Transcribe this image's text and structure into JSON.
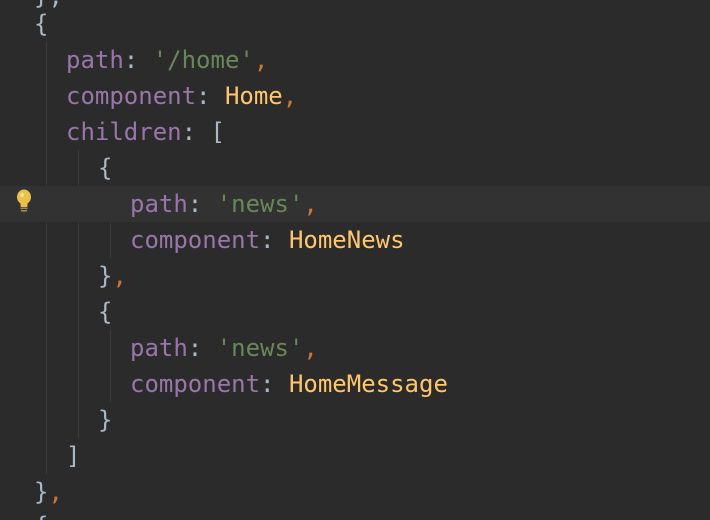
{
  "editor": {
    "colors": {
      "background": "#2b2b2b",
      "current_line": "#323232",
      "key": "#9876aa",
      "punctuation": "#cc7832",
      "string": "#6a8759",
      "identifier": "#ffc66d",
      "plain": "#a9b7c6"
    },
    "gutter_icon": "lightbulb-icon",
    "lines": [
      {
        "tokens": [
          {
            "text": "},",
            "cls": "tok-brace"
          }
        ]
      },
      {
        "tokens": [
          {
            "text": "{",
            "cls": "tok-brace"
          }
        ]
      },
      {
        "tokens": [
          {
            "text": "path",
            "cls": "tok-key"
          },
          {
            "text": ": ",
            "cls": "tok-plain"
          },
          {
            "text": "'/home'",
            "cls": "tok-str"
          },
          {
            "text": ",",
            "cls": "tok-punc"
          }
        ]
      },
      {
        "tokens": [
          {
            "text": "component",
            "cls": "tok-key"
          },
          {
            "text": ": ",
            "cls": "tok-plain"
          },
          {
            "text": "Home",
            "cls": "tok-ident"
          },
          {
            "text": ",",
            "cls": "tok-punc"
          }
        ]
      },
      {
        "tokens": [
          {
            "text": "children",
            "cls": "tok-key"
          },
          {
            "text": ": ",
            "cls": "tok-plain"
          },
          {
            "text": "[",
            "cls": "tok-brace"
          }
        ]
      },
      {
        "tokens": [
          {
            "text": "{",
            "cls": "tok-brace"
          }
        ]
      },
      {
        "tokens": [
          {
            "text": "path",
            "cls": "tok-key"
          },
          {
            "text": ": ",
            "cls": "tok-plain"
          },
          {
            "text": "'news'",
            "cls": "tok-str"
          },
          {
            "text": ",",
            "cls": "tok-punc"
          }
        ]
      },
      {
        "tokens": [
          {
            "text": "component",
            "cls": "tok-key"
          },
          {
            "text": ": ",
            "cls": "tok-plain"
          },
          {
            "text": "HomeNews",
            "cls": "tok-ident"
          }
        ]
      },
      {
        "tokens": [
          {
            "text": "}",
            "cls": "tok-brace"
          },
          {
            "text": ",",
            "cls": "tok-punc"
          }
        ]
      },
      {
        "tokens": [
          {
            "text": "{",
            "cls": "tok-brace"
          }
        ]
      },
      {
        "tokens": [
          {
            "text": "path",
            "cls": "tok-key"
          },
          {
            "text": ": ",
            "cls": "tok-plain"
          },
          {
            "text": "'news'",
            "cls": "tok-str"
          },
          {
            "text": ",",
            "cls": "tok-punc"
          }
        ]
      },
      {
        "tokens": [
          {
            "text": "component",
            "cls": "tok-key"
          },
          {
            "text": ": ",
            "cls": "tok-plain"
          },
          {
            "text": "HomeMessage",
            "cls": "tok-ident"
          }
        ]
      },
      {
        "tokens": [
          {
            "text": "}",
            "cls": "tok-brace"
          }
        ]
      },
      {
        "tokens": [
          {
            "text": "]",
            "cls": "tok-brace"
          }
        ]
      },
      {
        "tokens": [
          {
            "text": "}",
            "cls": "tok-brace"
          },
          {
            "text": ",",
            "cls": "tok-punc"
          }
        ]
      },
      {
        "tokens": [
          {
            "text": "{",
            "cls": "tok-brace"
          }
        ]
      }
    ]
  }
}
